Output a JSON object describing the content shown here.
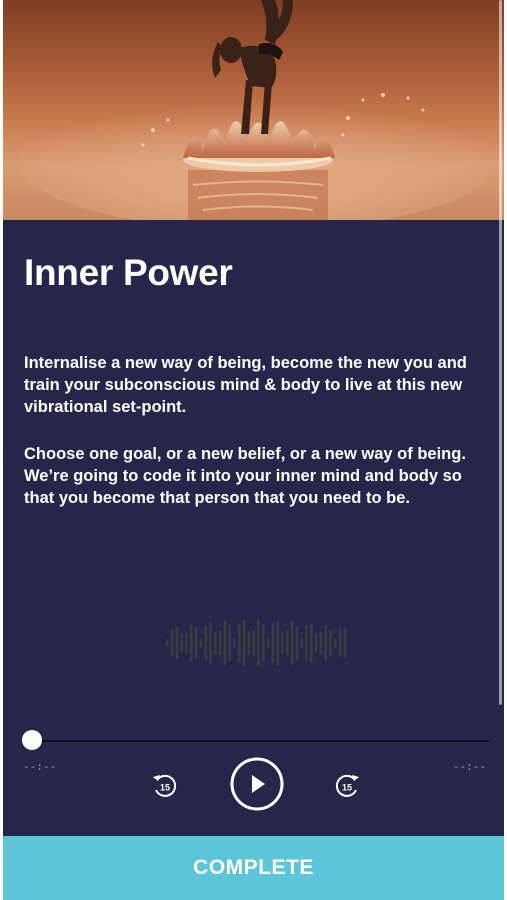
{
  "session": {
    "title": "Inner Power",
    "description_1": "Internalise a new way of being, become the new you and train your subconscious mind & body to live at this new vibrational set-point.",
    "description_2": "Choose one goal, or a new belief, or a new way of being. We’re going to code it into your inner mind and body so that you become that person that you need to be."
  },
  "hero_image": {
    "subject": "woman balancing on hands over a water splash"
  },
  "player": {
    "elapsed": "--:--",
    "remaining": "--:--",
    "skip_back_label": "15",
    "skip_forward_label": "15",
    "progress": 0,
    "state": "paused",
    "icons": {
      "skip_back": "rewind-15-icon",
      "play": "play-icon",
      "skip_forward": "forward-15-icon",
      "waveform": "waveform-icon"
    }
  },
  "complete_button": {
    "label": "COMPLETE"
  },
  "colors": {
    "background": "#25274a",
    "accent": "#5cc5da",
    "text": "#ffffff"
  }
}
